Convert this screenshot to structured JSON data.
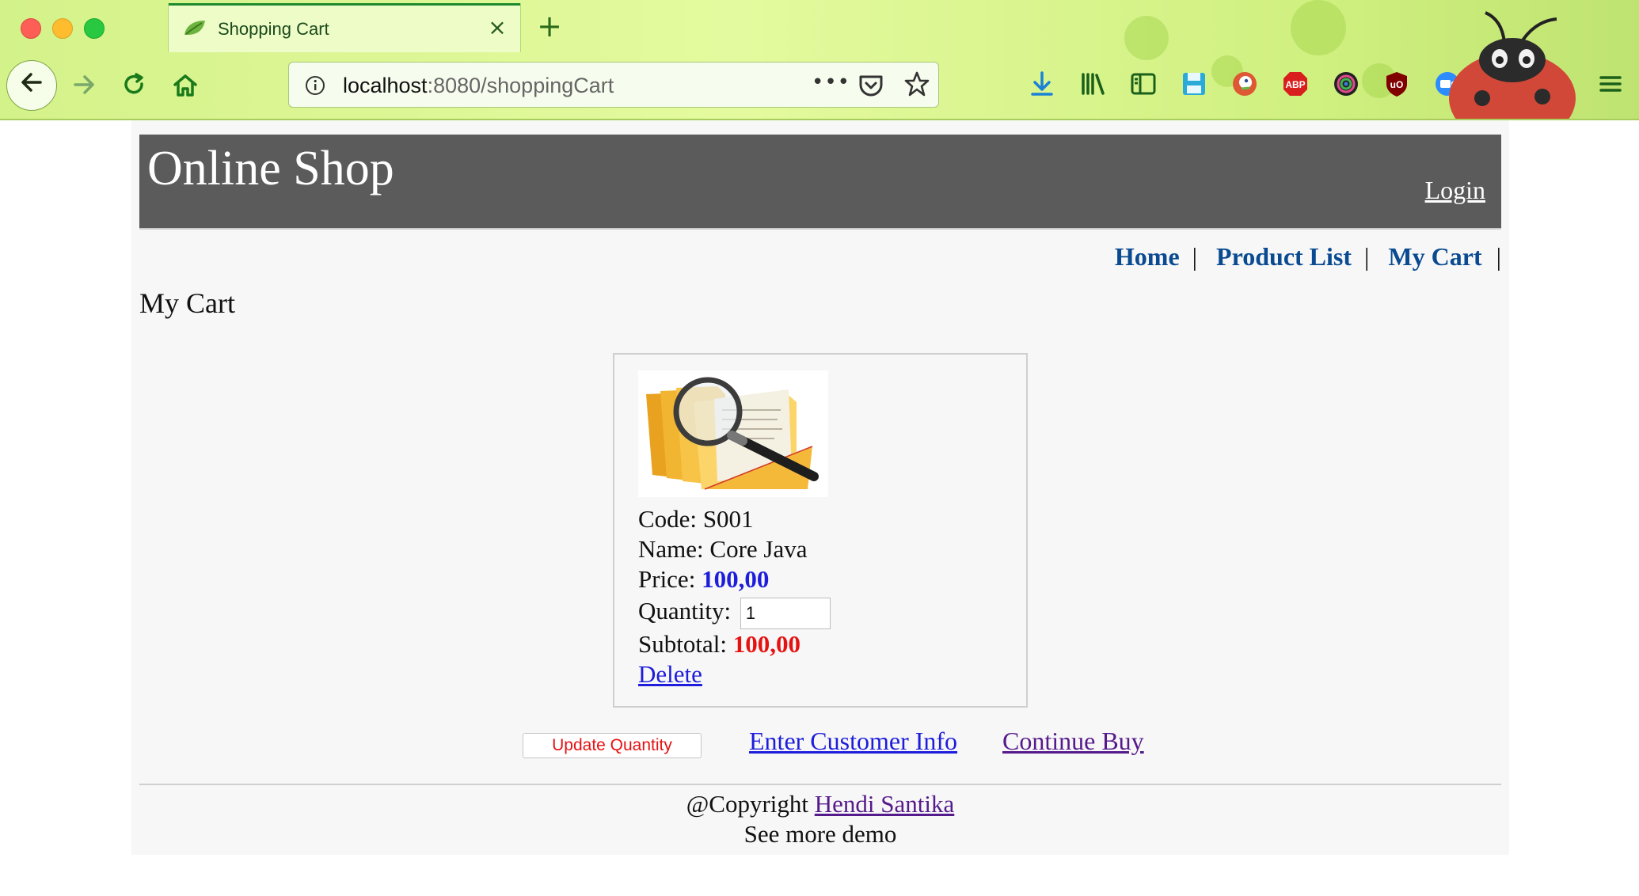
{
  "browser": {
    "tab_title": "Shopping Cart",
    "tab_close": "×",
    "new_tab": "+",
    "url_host": "localhost",
    "url_path": ":8080/shoppingCart",
    "url_more": "•••",
    "toolbar_icons": [
      "download-icon",
      "library-icon",
      "sidebar-icon",
      "save-icon",
      "duckduckgo-icon",
      "adblock-plus-icon",
      "color-picker-icon",
      "ublock-icon",
      "zoom-icon",
      "translate-icon",
      "extension-icon",
      "menu-icon"
    ],
    "abp_label": "ABP",
    "ublock_label": "uO"
  },
  "header": {
    "site_title": "Online Shop",
    "login_label": "Login"
  },
  "menu": {
    "items": [
      {
        "label": "Home"
      },
      {
        "label": "Product List"
      },
      {
        "label": "My Cart"
      }
    ],
    "separator": "|"
  },
  "page": {
    "heading": "My Cart"
  },
  "cart": {
    "items": [
      {
        "code_label": "Code:",
        "code": "S001",
        "name_label": "Name:",
        "name": "Core Java",
        "price_label": "Price:",
        "price": "100,00",
        "quantity_label": "Quantity:",
        "quantity": "1",
        "subtotal_label": "Subtotal:",
        "subtotal": "100,00",
        "delete_label": "Delete",
        "image": "folder-magnifier-icon"
      }
    ],
    "update_label": "Update Quantity",
    "enter_info_label": "Enter Customer Info",
    "continue_label": "Continue Buy"
  },
  "footer": {
    "copyright_prefix": "@Copyright",
    "author": "Hendi Santika",
    "more_demo": "See more demo"
  },
  "colors": {
    "header_bg": "#5b5b5b",
    "link_menu": "#0a4a91",
    "price": "#1d1ddb",
    "subtotal": "#e61212",
    "visited_link": "#551a8b",
    "chrome_green": "#d4f28a"
  }
}
